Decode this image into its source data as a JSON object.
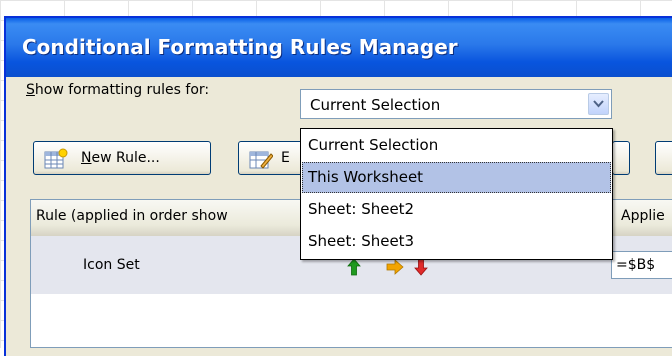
{
  "dialog": {
    "title": "Conditional Formatting Rules Manager"
  },
  "show_rules": {
    "label_first": "S",
    "label_rest": "how formatting rules for:",
    "selected": "Current Selection",
    "options": [
      "Current Selection",
      "This Worksheet",
      "Sheet: Sheet2",
      "Sheet: Sheet3"
    ],
    "highlighted_index": 1
  },
  "toolbar": {
    "new_rule_first": "N",
    "new_rule_rest": "ew Rule...",
    "edit_rule_partial": "E"
  },
  "rules_table": {
    "col_rule": "Rule (applied in order show",
    "col_applies": "Applie",
    "rows": [
      {
        "type": "Icon Set",
        "applies_to": "=$B$"
      }
    ]
  },
  "colors": {
    "titlebar": "#2a78ea",
    "dialog_bg": "#ece9d8",
    "highlight": "#b2c2e6",
    "selected_row": "#e4e6ee",
    "arrow_up": "#1f9a1f",
    "arrow_side": "#f2a400",
    "arrow_down": "#e02a2a"
  },
  "icons": [
    "new-rule-icon",
    "edit-rule-icon",
    "dropdown-chevron-icon",
    "icon-set-arrows-icon"
  ]
}
